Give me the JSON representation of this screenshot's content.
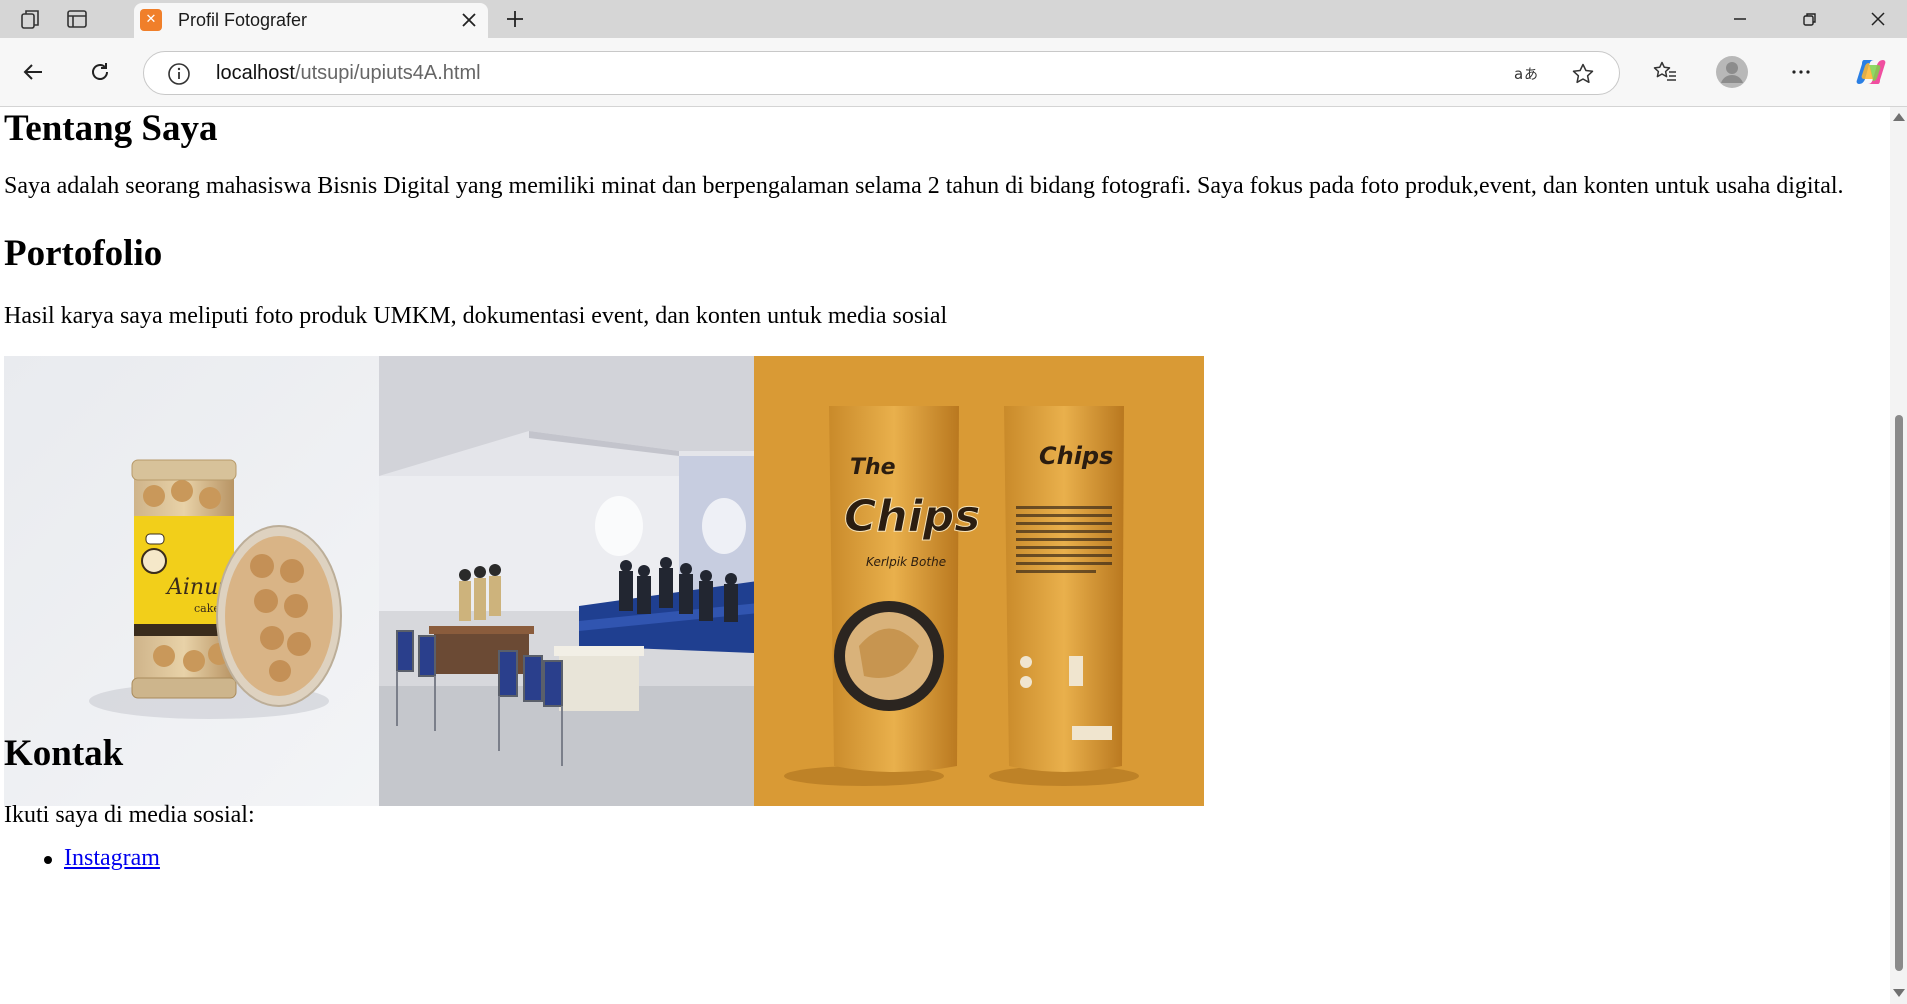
{
  "browser": {
    "tab_title": "Profil Fotografer",
    "url_host": "localhost",
    "url_path": "/utsupi/upiuts4A.html"
  },
  "page": {
    "about_heading": "Tentang Saya",
    "about_text": "Saya adalah seorang mahasiswa Bisnis Digital yang memiliki minat dan berpengalaman selama 2 tahun di bidang fotografi. Saya fokus pada foto produk,event, dan konten untuk usaha digital.",
    "portfolio_heading": "Portofolio",
    "portfolio_text": "Hasil karya saya meliputi foto produk UMKM, dokumentasi event, dan konten untuk media sosial",
    "photos": {
      "cookie_brand": "Ainun",
      "cookie_sub": "cake",
      "chips_title_1": "The",
      "chips_title_2": "Chips",
      "chips_sub": "Kerlpik Bothe"
    },
    "contact_heading": "Kontak",
    "contact_text": "Ikuti saya di media sosial:",
    "contact_links": [
      "Instagram"
    ]
  },
  "colors": {
    "link": "#0000ee",
    "tab_favicon": "#f07f2a",
    "chips_background": "#d99a35"
  }
}
